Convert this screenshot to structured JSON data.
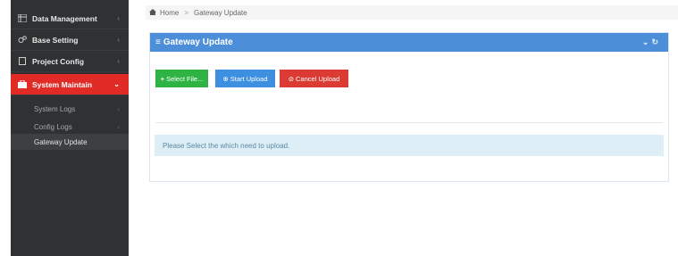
{
  "sidebar": {
    "items": [
      {
        "label": "Data Management",
        "icon": "grid-icon"
      },
      {
        "label": "Base Setting",
        "icon": "gears-icon"
      },
      {
        "label": "Project Config",
        "icon": "file-icon"
      },
      {
        "label": "System Maintain",
        "icon": "toolbox-icon",
        "active": true
      }
    ],
    "subitems": [
      {
        "label": "System Logs"
      },
      {
        "label": "Config Logs"
      },
      {
        "label": "Gateway Update",
        "current": true
      }
    ]
  },
  "breadcrumb": {
    "home": "Home",
    "separator": ">",
    "current": "Gateway Update"
  },
  "panel": {
    "title": "Gateway Update",
    "buttons": {
      "select": "Select File...",
      "start": "Start Upload",
      "cancel": "Cancel Upload"
    },
    "info": "Please Select the which need to upload."
  },
  "colors": {
    "active_nav": "#e02b27",
    "panel_header": "#4c8fd8",
    "btn_green": "#2fb344",
    "btn_blue": "#3d8fe0",
    "btn_red": "#dc3b34"
  }
}
